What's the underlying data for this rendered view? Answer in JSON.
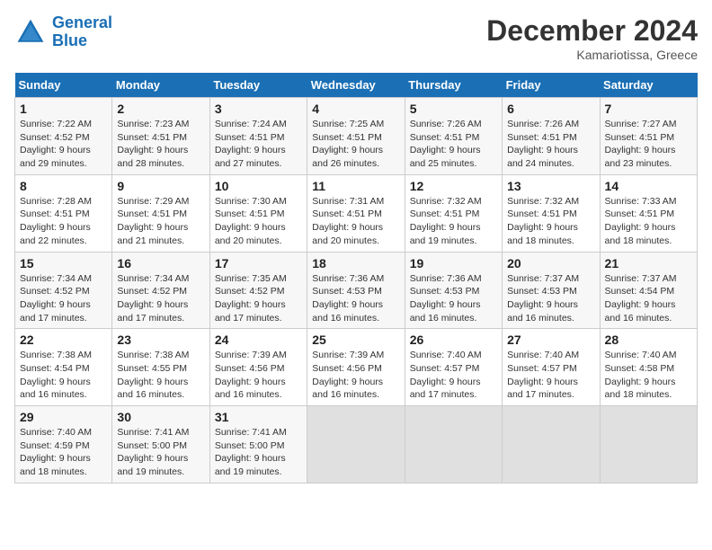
{
  "header": {
    "logo_line1": "General",
    "logo_line2": "Blue",
    "month": "December 2024",
    "location": "Kamariotissa, Greece"
  },
  "days_of_week": [
    "Sunday",
    "Monday",
    "Tuesday",
    "Wednesday",
    "Thursday",
    "Friday",
    "Saturday"
  ],
  "weeks": [
    [
      {
        "day": "1",
        "info": "Sunrise: 7:22 AM\nSunset: 4:52 PM\nDaylight: 9 hours\nand 29 minutes."
      },
      {
        "day": "2",
        "info": "Sunrise: 7:23 AM\nSunset: 4:51 PM\nDaylight: 9 hours\nand 28 minutes."
      },
      {
        "day": "3",
        "info": "Sunrise: 7:24 AM\nSunset: 4:51 PM\nDaylight: 9 hours\nand 27 minutes."
      },
      {
        "day": "4",
        "info": "Sunrise: 7:25 AM\nSunset: 4:51 PM\nDaylight: 9 hours\nand 26 minutes."
      },
      {
        "day": "5",
        "info": "Sunrise: 7:26 AM\nSunset: 4:51 PM\nDaylight: 9 hours\nand 25 minutes."
      },
      {
        "day": "6",
        "info": "Sunrise: 7:26 AM\nSunset: 4:51 PM\nDaylight: 9 hours\nand 24 minutes."
      },
      {
        "day": "7",
        "info": "Sunrise: 7:27 AM\nSunset: 4:51 PM\nDaylight: 9 hours\nand 23 minutes."
      }
    ],
    [
      {
        "day": "8",
        "info": "Sunrise: 7:28 AM\nSunset: 4:51 PM\nDaylight: 9 hours\nand 22 minutes."
      },
      {
        "day": "9",
        "info": "Sunrise: 7:29 AM\nSunset: 4:51 PM\nDaylight: 9 hours\nand 21 minutes."
      },
      {
        "day": "10",
        "info": "Sunrise: 7:30 AM\nSunset: 4:51 PM\nDaylight: 9 hours\nand 20 minutes."
      },
      {
        "day": "11",
        "info": "Sunrise: 7:31 AM\nSunset: 4:51 PM\nDaylight: 9 hours\nand 20 minutes."
      },
      {
        "day": "12",
        "info": "Sunrise: 7:32 AM\nSunset: 4:51 PM\nDaylight: 9 hours\nand 19 minutes."
      },
      {
        "day": "13",
        "info": "Sunrise: 7:32 AM\nSunset: 4:51 PM\nDaylight: 9 hours\nand 18 minutes."
      },
      {
        "day": "14",
        "info": "Sunrise: 7:33 AM\nSunset: 4:51 PM\nDaylight: 9 hours\nand 18 minutes."
      }
    ],
    [
      {
        "day": "15",
        "info": "Sunrise: 7:34 AM\nSunset: 4:52 PM\nDaylight: 9 hours\nand 17 minutes."
      },
      {
        "day": "16",
        "info": "Sunrise: 7:34 AM\nSunset: 4:52 PM\nDaylight: 9 hours\nand 17 minutes."
      },
      {
        "day": "17",
        "info": "Sunrise: 7:35 AM\nSunset: 4:52 PM\nDaylight: 9 hours\nand 17 minutes."
      },
      {
        "day": "18",
        "info": "Sunrise: 7:36 AM\nSunset: 4:53 PM\nDaylight: 9 hours\nand 16 minutes."
      },
      {
        "day": "19",
        "info": "Sunrise: 7:36 AM\nSunset: 4:53 PM\nDaylight: 9 hours\nand 16 minutes."
      },
      {
        "day": "20",
        "info": "Sunrise: 7:37 AM\nSunset: 4:53 PM\nDaylight: 9 hours\nand 16 minutes."
      },
      {
        "day": "21",
        "info": "Sunrise: 7:37 AM\nSunset: 4:54 PM\nDaylight: 9 hours\nand 16 minutes."
      }
    ],
    [
      {
        "day": "22",
        "info": "Sunrise: 7:38 AM\nSunset: 4:54 PM\nDaylight: 9 hours\nand 16 minutes."
      },
      {
        "day": "23",
        "info": "Sunrise: 7:38 AM\nSunset: 4:55 PM\nDaylight: 9 hours\nand 16 minutes."
      },
      {
        "day": "24",
        "info": "Sunrise: 7:39 AM\nSunset: 4:56 PM\nDaylight: 9 hours\nand 16 minutes."
      },
      {
        "day": "25",
        "info": "Sunrise: 7:39 AM\nSunset: 4:56 PM\nDaylight: 9 hours\nand 16 minutes."
      },
      {
        "day": "26",
        "info": "Sunrise: 7:40 AM\nSunset: 4:57 PM\nDaylight: 9 hours\nand 17 minutes."
      },
      {
        "day": "27",
        "info": "Sunrise: 7:40 AM\nSunset: 4:57 PM\nDaylight: 9 hours\nand 17 minutes."
      },
      {
        "day": "28",
        "info": "Sunrise: 7:40 AM\nSunset: 4:58 PM\nDaylight: 9 hours\nand 18 minutes."
      }
    ],
    [
      {
        "day": "29",
        "info": "Sunrise: 7:40 AM\nSunset: 4:59 PM\nDaylight: 9 hours\nand 18 minutes."
      },
      {
        "day": "30",
        "info": "Sunrise: 7:41 AM\nSunset: 5:00 PM\nDaylight: 9 hours\nand 19 minutes."
      },
      {
        "day": "31",
        "info": "Sunrise: 7:41 AM\nSunset: 5:00 PM\nDaylight: 9 hours\nand 19 minutes."
      },
      null,
      null,
      null,
      null
    ]
  ]
}
